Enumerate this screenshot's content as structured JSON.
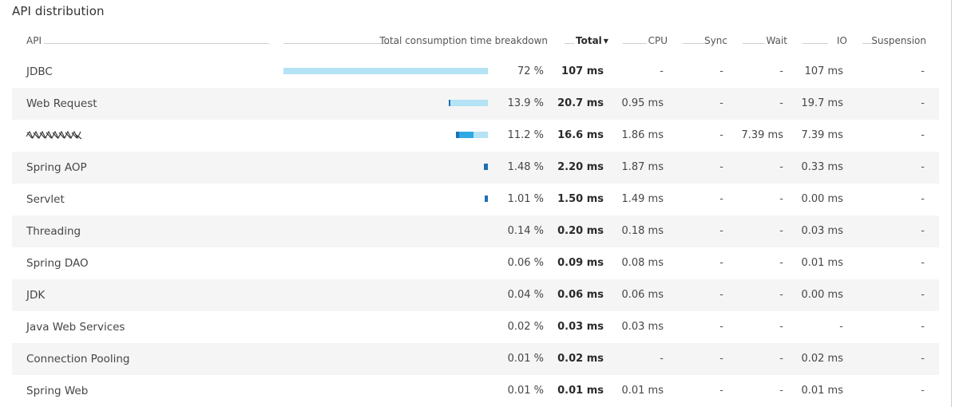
{
  "title": "API distribution",
  "colors": {
    "bar_light": "#b3e3f5",
    "bar_mid": "#2ea9e3",
    "bar_dark": "#1f6fb5"
  },
  "columns": {
    "api": "API",
    "breakdown": "Total consumption time breakdown",
    "total": "Total",
    "total_sort_icon": "▼",
    "cpu": "CPU",
    "sync": "Sync",
    "wait": "Wait",
    "io": "IO",
    "suspension": "Suspension"
  },
  "rows": [
    {
      "api": "JDBC",
      "pct": "72 %",
      "total": "107 ms",
      "cpu": "-",
      "sync": "-",
      "wait": "-",
      "io": "107 ms",
      "suspension": "-",
      "breakdown": {
        "share": 0.72,
        "cpu": 0,
        "wait": 0,
        "io": 1
      }
    },
    {
      "api": "Web Request",
      "pct": "13.9 %",
      "total": "20.7 ms",
      "cpu": "0.95 ms",
      "sync": "-",
      "wait": "-",
      "io": "19.7 ms",
      "suspension": "-",
      "breakdown": {
        "share": 0.139,
        "cpu": 0.046,
        "wait": 0,
        "io": 0.954
      }
    },
    {
      "api": "",
      "redacted": true,
      "pct": "11.2 %",
      "total": "16.6 ms",
      "cpu": "1.86 ms",
      "sync": "-",
      "wait": "7.39 ms",
      "io": "7.39 ms",
      "suspension": "-",
      "breakdown": {
        "share": 0.112,
        "cpu": 0.112,
        "wait": 0.445,
        "io": 0.445
      }
    },
    {
      "api": "Spring AOP",
      "pct": "1.48 %",
      "total": "2.20 ms",
      "cpu": "1.87 ms",
      "sync": "-",
      "wait": "-",
      "io": "0.33 ms",
      "suspension": "-",
      "breakdown": {
        "share": 0.0148,
        "cpu": 1,
        "wait": 0,
        "io": 0
      }
    },
    {
      "api": "Servlet",
      "pct": "1.01 %",
      "total": "1.50 ms",
      "cpu": "1.49 ms",
      "sync": "-",
      "wait": "-",
      "io": "0.00 ms",
      "suspension": "-",
      "breakdown": {
        "share": 0.0101,
        "cpu": 1,
        "wait": 0,
        "io": 0
      }
    },
    {
      "api": "Threading",
      "pct": "0.14 %",
      "total": "0.20 ms",
      "cpu": "0.18 ms",
      "sync": "-",
      "wait": "-",
      "io": "0.03 ms",
      "suspension": "-",
      "breakdown": {
        "share": 0,
        "cpu": 0,
        "wait": 0,
        "io": 0
      }
    },
    {
      "api": "Spring DAO",
      "pct": "0.06 %",
      "total": "0.09 ms",
      "cpu": "0.08 ms",
      "sync": "-",
      "wait": "-",
      "io": "0.01 ms",
      "suspension": "-",
      "breakdown": {
        "share": 0,
        "cpu": 0,
        "wait": 0,
        "io": 0
      }
    },
    {
      "api": "JDK",
      "pct": "0.04 %",
      "total": "0.06 ms",
      "cpu": "0.06 ms",
      "sync": "-",
      "wait": "-",
      "io": "0.00 ms",
      "suspension": "-",
      "breakdown": {
        "share": 0,
        "cpu": 0,
        "wait": 0,
        "io": 0
      }
    },
    {
      "api": "Java Web Services",
      "pct": "0.02 %",
      "total": "0.03 ms",
      "cpu": "0.03 ms",
      "sync": "-",
      "wait": "-",
      "io": "-",
      "suspension": "-",
      "breakdown": {
        "share": 0,
        "cpu": 0,
        "wait": 0,
        "io": 0
      }
    },
    {
      "api": "Connection Pooling",
      "pct": "0.01 %",
      "total": "0.02 ms",
      "cpu": "-",
      "sync": "-",
      "wait": "-",
      "io": "0.02 ms",
      "suspension": "-",
      "breakdown": {
        "share": 0,
        "cpu": 0,
        "wait": 0,
        "io": 0
      }
    },
    {
      "api": "Spring Web",
      "pct": "0.01 %",
      "total": "0.01 ms",
      "cpu": "0.01 ms",
      "sync": "-",
      "wait": "-",
      "io": "0.01 ms",
      "suspension": "-",
      "breakdown": {
        "share": 0,
        "cpu": 0,
        "wait": 0,
        "io": 0
      }
    }
  ]
}
